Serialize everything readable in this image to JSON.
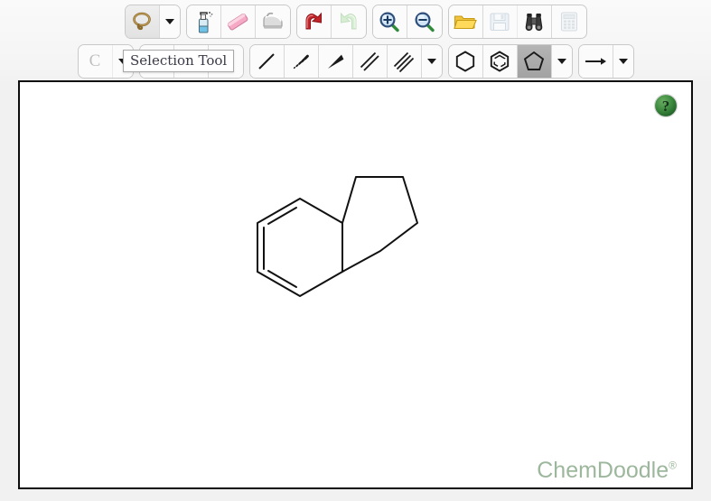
{
  "app": {
    "title": "ChemDoodle Web Sketcher",
    "watermark": "ChemDoodle",
    "watermark_mark": "®",
    "watermark_color": "#9db79d",
    "canvas_bg": "#ffffff",
    "canvas_border_color": "#0d0d0d",
    "page_bg": "#f1f1f1"
  },
  "tooltip": {
    "text": "Selection Tool",
    "visible": true
  },
  "help": {
    "label": "?",
    "name": "help-button",
    "color": "#2e7d32"
  },
  "toolbar_row1": {
    "groups": [
      {
        "name": "selection-group",
        "buttons": [
          {
            "name": "lasso-select-icon",
            "label": "Selection Tool",
            "state": "hovered",
            "icon": "lasso"
          },
          {
            "name": "selection-dropdown",
            "label": "Selection Tool Options",
            "state": "normal",
            "icon": "caret"
          }
        ]
      },
      {
        "name": "edit-group",
        "buttons": [
          {
            "name": "clean-spray-icon",
            "label": "Clean Structure",
            "state": "normal",
            "icon": "spray"
          },
          {
            "name": "eraser-icon",
            "label": "Erase",
            "state": "normal",
            "icon": "eraser"
          },
          {
            "name": "flatten-iron-icon",
            "label": "Flatten",
            "state": "normal",
            "icon": "iron"
          }
        ]
      },
      {
        "name": "history-group",
        "buttons": [
          {
            "name": "undo-icon",
            "label": "Undo",
            "state": "normal",
            "icon": "undo"
          },
          {
            "name": "redo-icon",
            "label": "Redo",
            "state": "disabled",
            "icon": "redo"
          }
        ]
      },
      {
        "name": "zoom-group",
        "buttons": [
          {
            "name": "zoom-in-icon",
            "label": "Zoom In",
            "state": "normal",
            "icon": "zoomin"
          },
          {
            "name": "zoom-out-icon",
            "label": "Zoom Out",
            "state": "normal",
            "icon": "zoomout"
          }
        ]
      },
      {
        "name": "file-group",
        "buttons": [
          {
            "name": "open-folder-icon",
            "label": "Open",
            "state": "normal",
            "icon": "folder"
          },
          {
            "name": "save-disk-icon",
            "label": "Save",
            "state": "disabled",
            "icon": "save"
          },
          {
            "name": "search-binoculars-icon",
            "label": "Search",
            "state": "normal",
            "icon": "binoculars"
          },
          {
            "name": "calculator-icon",
            "label": "Calculate",
            "state": "disabled",
            "icon": "calculator"
          }
        ]
      }
    ]
  },
  "toolbar_row2": {
    "groups": [
      {
        "name": "label-group",
        "buttons": [
          {
            "name": "carbon-label-icon",
            "label": "C",
            "state": "disabled",
            "icon": "text-c"
          },
          {
            "name": "label-dropdown",
            "label": "Label Options",
            "state": "normal",
            "icon": "caret"
          }
        ]
      },
      {
        "name": "hidden-group",
        "buttons": [
          {
            "name": "hidden-tool-1",
            "label": "",
            "state": "normal",
            "icon": "blank"
          },
          {
            "name": "hidden-tool-2",
            "label": "",
            "state": "normal",
            "icon": "blank"
          },
          {
            "name": "hidden-tool-3",
            "label": "",
            "state": "normal",
            "icon": "blank"
          }
        ]
      },
      {
        "name": "bond-group",
        "buttons": [
          {
            "name": "single-bond-icon",
            "label": "Single Bond",
            "state": "normal",
            "icon": "bond-single"
          },
          {
            "name": "hashed-wedge-bond-icon",
            "label": "Hashed Wedge Bond",
            "state": "normal",
            "icon": "bond-hash"
          },
          {
            "name": "wedge-bond-icon",
            "label": "Wedge Bond",
            "state": "normal",
            "icon": "bond-wedge"
          },
          {
            "name": "double-bond-icon",
            "label": "Double Bond",
            "state": "normal",
            "icon": "bond-double"
          },
          {
            "name": "triple-bond-icon",
            "label": "Triple Bond",
            "state": "normal",
            "icon": "bond-triple"
          },
          {
            "name": "bond-dropdown",
            "label": "Bond Options",
            "state": "normal",
            "icon": "caret"
          }
        ]
      },
      {
        "name": "ring-group",
        "buttons": [
          {
            "name": "cyclohexane-ring-icon",
            "label": "Cyclohexane",
            "state": "normal",
            "icon": "hexagon"
          },
          {
            "name": "benzene-ring-icon",
            "label": "Benzene",
            "state": "normal",
            "icon": "benzene"
          },
          {
            "name": "cyclopentane-ring-icon",
            "label": "Cyclopentane",
            "state": "selected",
            "icon": "pentagon"
          },
          {
            "name": "ring-dropdown",
            "label": "Ring Options",
            "state": "normal",
            "icon": "caret"
          }
        ]
      },
      {
        "name": "arrow-group",
        "buttons": [
          {
            "name": "reaction-arrow-icon",
            "label": "Arrow",
            "state": "normal",
            "icon": "arrow"
          },
          {
            "name": "arrow-dropdown",
            "label": "Arrow Options",
            "state": "normal",
            "icon": "caret"
          }
        ]
      }
    ]
  },
  "structure": {
    "name": "indane-molecule",
    "description": "Bicyclic structure: benzene ring fused to cyclopentane ring",
    "bond_color": "#111111",
    "bond_width": 2
  }
}
